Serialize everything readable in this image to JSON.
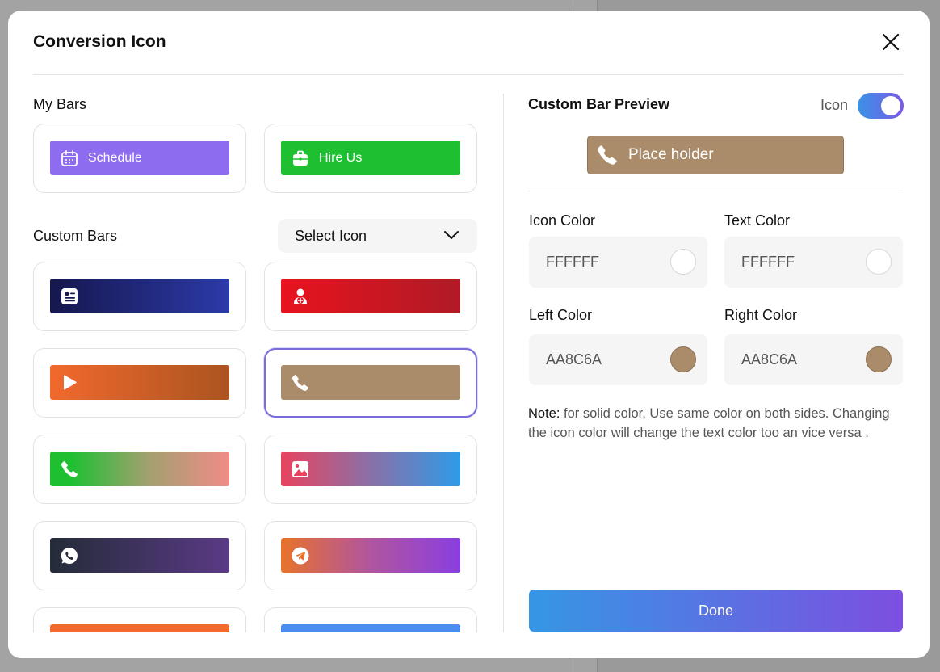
{
  "modal": {
    "title": "Conversion Icon",
    "close_icon": "close-icon"
  },
  "my_bars": {
    "title": "My Bars",
    "items": [
      {
        "label": "Schedule",
        "icon": "calendar-icon",
        "color": "#8E6CF0"
      },
      {
        "label": "Hire Us",
        "icon": "briefcase-icon",
        "color": "#1EC032"
      }
    ]
  },
  "custom_bars": {
    "title": "Custom Bars",
    "select_icon": "Select Icon",
    "items": [
      {
        "icon": "contact-card-icon",
        "left": "#16174E",
        "right": "#2C3AA8"
      },
      {
        "icon": "user-add-icon",
        "left": "#E8131E",
        "right": "#B01A26"
      },
      {
        "icon": "play-icon",
        "left": "#F2692D",
        "right": "#AA5420"
      },
      {
        "icon": "phone-icon",
        "left": "#AA8C6A",
        "right": "#AA8C6A",
        "selected": true
      },
      {
        "icon": "phone-icon",
        "left": "#1EC032",
        "right": "#F08C86"
      },
      {
        "icon": "image-icon",
        "left": "#E8445E",
        "right": "#2E9BE8"
      },
      {
        "icon": "whatsapp-icon",
        "left": "#242C38",
        "right": "#5A3A86"
      },
      {
        "icon": "telegram-icon",
        "left": "#E8722A",
        "right": "#8A3EE0"
      },
      {
        "icon": "",
        "left": "#F2692D",
        "right": "#F2692D"
      },
      {
        "icon": "",
        "left": "#4A8CF0",
        "right": "#4A8CF0"
      }
    ]
  },
  "preview": {
    "title": "Custom Bar Preview",
    "toggle_label": "Icon",
    "toggle_on": true,
    "bar_label": "Place holder",
    "bar_icon": "phone-icon"
  },
  "colors": {
    "icon_color": {
      "label": "Icon Color",
      "value": "FFFFFF",
      "hex": "#FFFFFF"
    },
    "text_color": {
      "label": "Text Color",
      "value": "FFFFFF",
      "hex": "#FFFFFF"
    },
    "left_color": {
      "label": "Left Color",
      "value": "AA8C6A",
      "hex": "#AA8C6A"
    },
    "right_color": {
      "label": "Right Color",
      "value": "AA8C6A",
      "hex": "#AA8C6A"
    }
  },
  "note": {
    "prefix": "Note:",
    "text": " for solid color, Use same color on both sides. Changing the icon color will change the text color too an vice versa ."
  },
  "done_label": "Done"
}
